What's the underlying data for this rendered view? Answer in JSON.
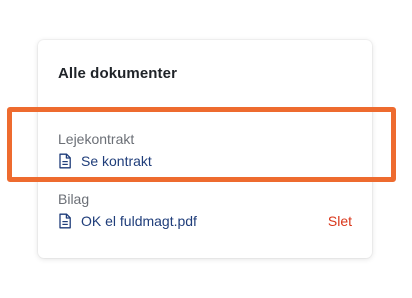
{
  "card": {
    "title": "Alle dokumenter"
  },
  "sections": [
    {
      "label": "Lejekontrakt",
      "document": {
        "icon": "document-icon",
        "link_text": "Se kontrakt"
      }
    },
    {
      "label": "Bilag",
      "document": {
        "icon": "document-icon",
        "link_text": "OK el fuldmagt.pdf",
        "delete_label": "Slet"
      }
    }
  ],
  "colors": {
    "link": "#1f3d7a",
    "delete": "#d9361a",
    "highlight": "#ee6b2f",
    "label": "#6b6f76"
  }
}
